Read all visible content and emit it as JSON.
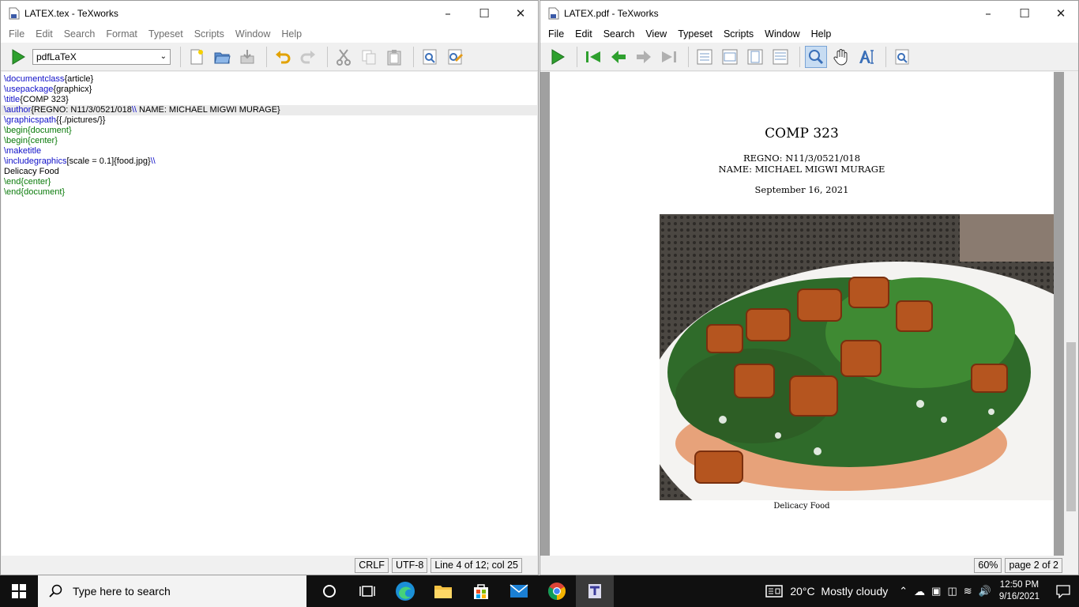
{
  "left_window": {
    "title": "LATEX.tex - TeXworks",
    "menus": [
      "File",
      "Edit",
      "Search",
      "Format",
      "Typeset",
      "Scripts",
      "Window",
      "Help"
    ],
    "typeset_engine": "pdfLaTeX",
    "editor_lines": {
      "l1_cmd": "\\documentclass",
      "l1_arg": "{article}",
      "l2_cmd": "\\usepackage",
      "l2_arg": "{graphicx}",
      "l3_cmd": "\\title",
      "l3_arg": "{COMP 323}",
      "l4_cmd": "\\author",
      "l4_arg": "{REGNO: N11/3/0521/018",
      "l4_bs": "\\\\",
      "l4_rest": " NAME: MICHAEL MIGWI MURAGE}",
      "l5_cmd": "\\graphicspath",
      "l5_arg": "{{./pictures/}}",
      "l6": "\\begin{document}",
      "l7": "\\begin{center}",
      "l8_cmd": "\\maketitle",
      "l9_cmd": "\\includegraphics",
      "l9_arg": "[scale = 0.1]{food.jpg}",
      "l9_bs": "\\\\",
      "l10": "Delicacy Food",
      "l11": "\\end{center}",
      "l12": "\\end{document}"
    },
    "status": {
      "line_ending": "CRLF",
      "encoding": "UTF-8",
      "position": "Line 4 of 12; col 25"
    }
  },
  "right_window": {
    "title": "LATEX.pdf - TeXworks",
    "menus": [
      "File",
      "Edit",
      "Search",
      "View",
      "Typeset",
      "Scripts",
      "Window",
      "Help"
    ],
    "pdf": {
      "title": "COMP 323",
      "author_line1": "REGNO: N11/3/0521/018",
      "author_line2": "NAME: MICHAEL MIGWI MURAGE",
      "date": "September 16, 2021",
      "caption": "Delicacy Food"
    },
    "status": {
      "zoom": "60%",
      "page": "page 2 of 2"
    }
  },
  "taskbar": {
    "search_placeholder": "Type here to search",
    "weather": "20°C  Mostly cloudy",
    "time": "12:50 PM",
    "date": "9/16/2021"
  }
}
